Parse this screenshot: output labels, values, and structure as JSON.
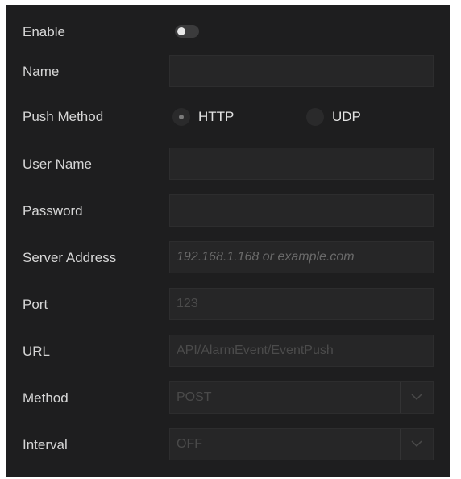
{
  "form": {
    "enable": {
      "label": "Enable",
      "value": false
    },
    "name": {
      "label": "Name",
      "value": ""
    },
    "push_method": {
      "label": "Push Method",
      "options": [
        "HTTP",
        "UDP"
      ],
      "selected": "HTTP"
    },
    "user_name": {
      "label": "User Name",
      "value": ""
    },
    "password": {
      "label": "Password",
      "value": ""
    },
    "server_address": {
      "label": "Server Address",
      "value": "",
      "placeholder": "192.168.1.168 or example.com"
    },
    "port": {
      "label": "Port",
      "value": "123"
    },
    "url": {
      "label": "URL",
      "value": "API/AlarmEvent/EventPush"
    },
    "method": {
      "label": "Method",
      "value": "POST"
    },
    "interval": {
      "label": "Interval",
      "value": "OFF"
    }
  }
}
